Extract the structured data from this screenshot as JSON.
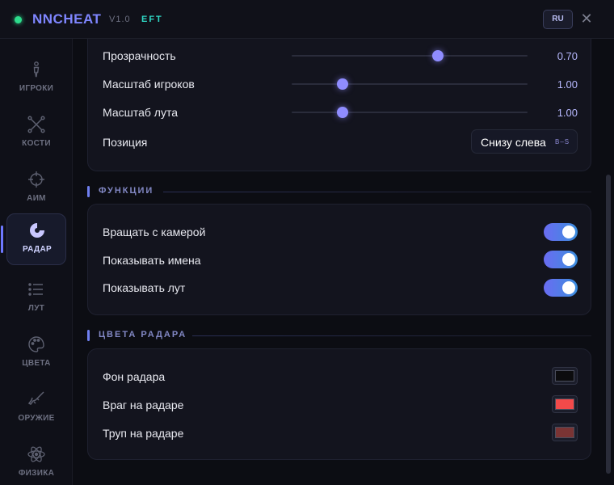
{
  "titlebar": {
    "app_name": "NNCHEAT",
    "version": "V1.0",
    "game": "EFT",
    "lang_button": "RU",
    "close_glyph": "✕",
    "status_color": "#2ddc8c"
  },
  "sidebar": {
    "items": [
      {
        "label": "ИГРОКИ",
        "icon": "person-icon",
        "active": false
      },
      {
        "label": "КОСТИ",
        "icon": "bones-icon",
        "active": false
      },
      {
        "label": "АИМ",
        "icon": "crosshair-icon",
        "active": false
      },
      {
        "label": "РАДАР",
        "icon": "radar-icon",
        "active": true
      },
      {
        "label": "ЛУТ",
        "icon": "list-icon",
        "active": false
      },
      {
        "label": "ЦВЕТА",
        "icon": "palette-icon",
        "active": false
      },
      {
        "label": "ОРУЖИЕ",
        "icon": "rifle-icon",
        "active": false
      },
      {
        "label": "ФИЗИКА",
        "icon": "atom-icon",
        "active": false
      }
    ]
  },
  "settings_card": {
    "sliders": [
      {
        "label": "Прозрачность",
        "value": "0.70",
        "fraction": 0.62
      },
      {
        "label": "Масштаб игроков",
        "value": "1.00",
        "fraction": 0.21
      },
      {
        "label": "Масштаб лута",
        "value": "1.00",
        "fraction": 0.21
      }
    ],
    "position": {
      "label": "Позиция",
      "value": "Снизу слева",
      "hint": "B–S"
    }
  },
  "functions": {
    "title": "ФУНКЦИИ",
    "toggles": [
      {
        "label": "Вращать с камерой",
        "on": true
      },
      {
        "label": "Показывать имена",
        "on": true
      },
      {
        "label": "Показывать лут",
        "on": true
      }
    ]
  },
  "radar_colors": {
    "title": "ЦВЕТА РАДАРА",
    "items": [
      {
        "label": "Фон радара",
        "color": "#0c0c0e"
      },
      {
        "label": "Враг на радаре",
        "color": "#f24a4a"
      },
      {
        "label": "Труп на радаре",
        "color": "#7a3434"
      }
    ]
  },
  "theme": {
    "accent": "#7f86ff",
    "toggle_on": "#5a7cf0"
  }
}
